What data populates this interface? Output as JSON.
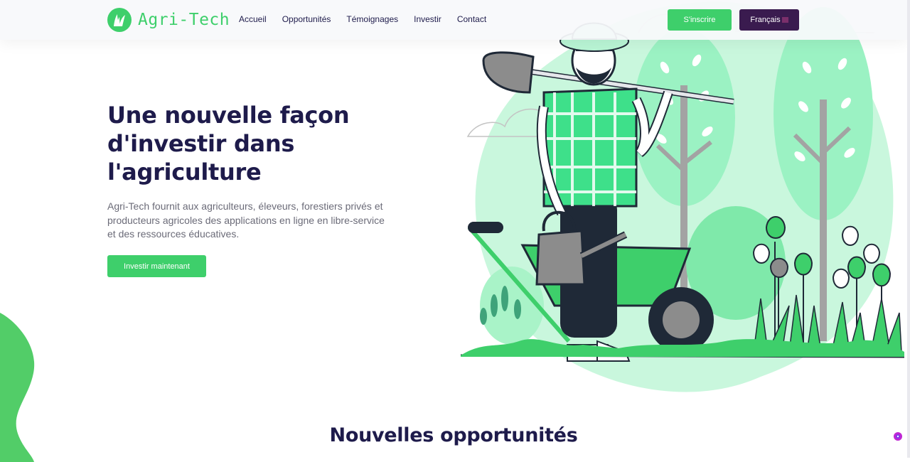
{
  "brand": {
    "name": "Agri-Tech",
    "icon": "leaf-logo-icon",
    "color": "#3ecf6b"
  },
  "nav": {
    "links": [
      "Accueil",
      "Opportunités",
      "Témoignages",
      "Investir",
      "Contact"
    ],
    "signup_label": "S'inscrire",
    "language_label": "Français"
  },
  "hero": {
    "title": "Une nouvelle façon d'investir dans l'agriculture",
    "description": "Agri-Tech fournit aux agriculteurs, éleveurs, forestiers privés et producteurs agricoles des applications en ligne en libre-service et des ressources éducatives.",
    "cta_label": "Investir maintenant",
    "illustration": "farmer-with-shovel-and-wheelbarrow-illustration"
  },
  "sections": {
    "opportunities_title": "Nouvelles opportunités"
  },
  "colors": {
    "primary_green": "#3ecf6b",
    "dark_navy": "#1e1b4b",
    "language_button": "#3a1b4f",
    "mint": "#c9f7dd"
  }
}
